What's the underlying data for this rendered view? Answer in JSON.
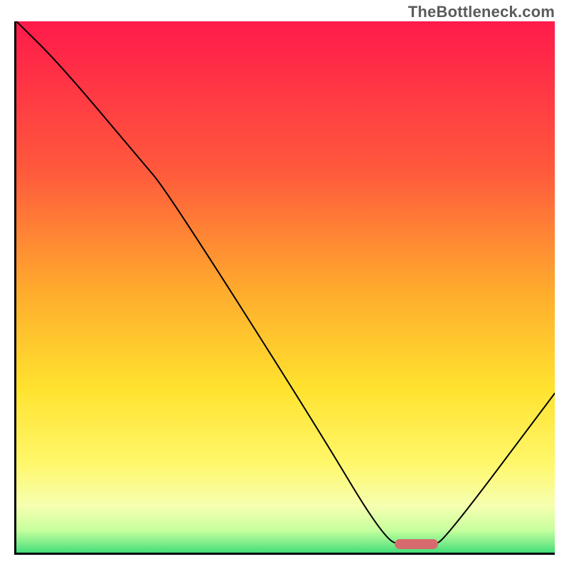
{
  "watermark": "TheBottleneck.com",
  "chart_data": {
    "type": "line",
    "title": "",
    "xlabel": "",
    "ylabel": "",
    "xlim": [
      0,
      100
    ],
    "ylim": [
      0,
      100
    ],
    "grid": false,
    "legend": false,
    "gradient_stops": [
      {
        "offset": 0.0,
        "color": "#ff1a4b"
      },
      {
        "offset": 0.28,
        "color": "#ff5a3c"
      },
      {
        "offset": 0.5,
        "color": "#ffab2d"
      },
      {
        "offset": 0.68,
        "color": "#ffe22e"
      },
      {
        "offset": 0.82,
        "color": "#fff76a"
      },
      {
        "offset": 0.9,
        "color": "#f6ffb0"
      },
      {
        "offset": 0.945,
        "color": "#c7ff9e"
      },
      {
        "offset": 0.975,
        "color": "#6be885"
      },
      {
        "offset": 1.0,
        "color": "#18d36a"
      }
    ],
    "series": [
      {
        "name": "bottleneck-curve",
        "x": [
          0,
          8,
          23,
          28,
          55,
          68,
          72,
          77,
          80,
          100
        ],
        "y": [
          100,
          92,
          74,
          68,
          25,
          3,
          1,
          1,
          3,
          30
        ]
      }
    ],
    "marker": {
      "name": "optimal-range",
      "x_start": 70,
      "x_end": 78,
      "y": 0.7,
      "color": "#d66a6e"
    }
  }
}
